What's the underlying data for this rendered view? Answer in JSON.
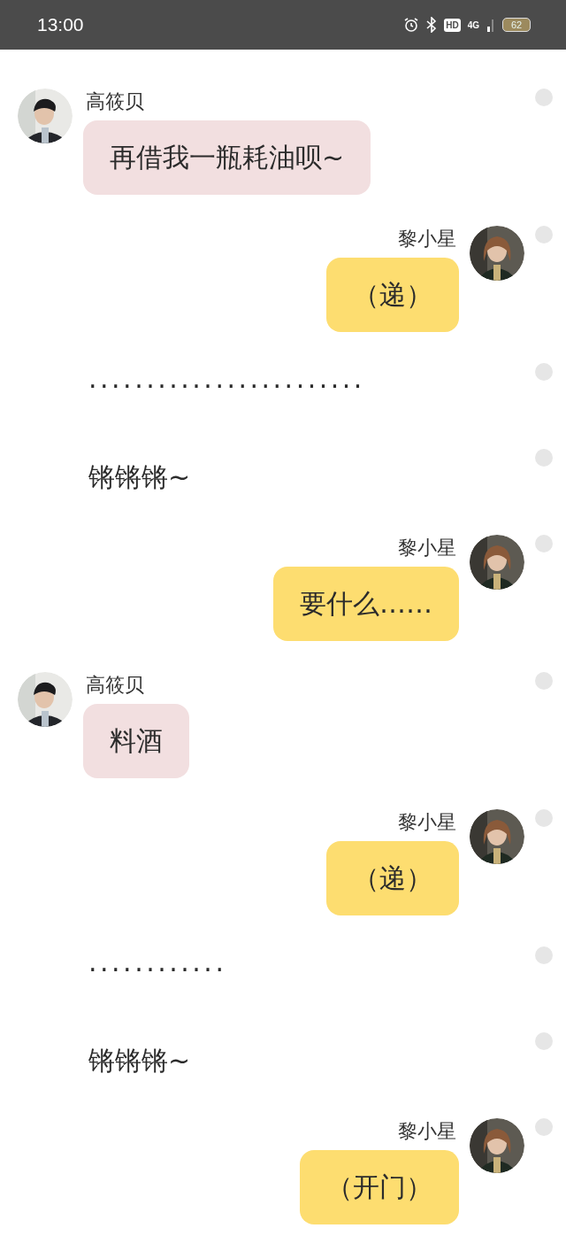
{
  "status_bar": {
    "time": "13:00",
    "hd": "HD",
    "network": "4G",
    "battery": "62"
  },
  "messages": [
    {
      "kind": "left",
      "sender": "高筱贝",
      "text": "再借我一瓶耗油呗~"
    },
    {
      "kind": "right",
      "sender": "黎小星",
      "text": "（递）"
    },
    {
      "kind": "plain",
      "text": "........................"
    },
    {
      "kind": "plain",
      "text": "锵锵锵~"
    },
    {
      "kind": "right",
      "sender": "黎小星",
      "text": "要什么……"
    },
    {
      "kind": "left",
      "sender": "高筱贝",
      "text": "料酒"
    },
    {
      "kind": "right",
      "sender": "黎小星",
      "text": "（递）"
    },
    {
      "kind": "plain",
      "text": "............"
    },
    {
      "kind": "plain",
      "text": "锵锵锵~"
    },
    {
      "kind": "right",
      "sender": "黎小星",
      "text": "（开门）"
    }
  ]
}
